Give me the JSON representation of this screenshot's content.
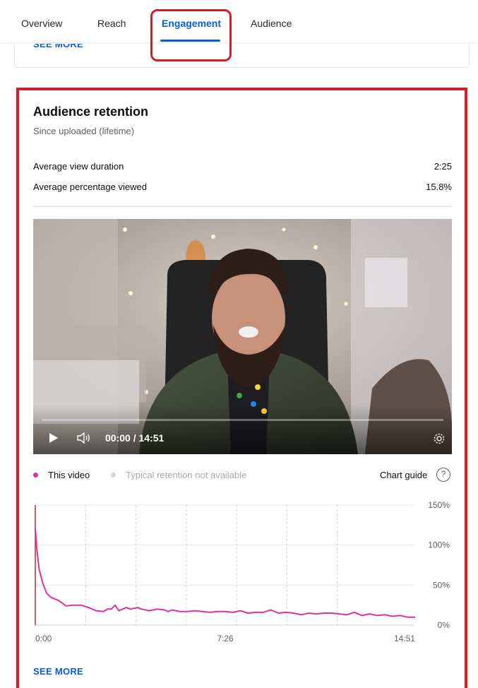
{
  "tabs": [
    {
      "label": "Overview"
    },
    {
      "label": "Reach"
    },
    {
      "label": "Engagement",
      "active": true
    },
    {
      "label": "Audience"
    }
  ],
  "top_card": {
    "see_more": "SEE MORE"
  },
  "retention": {
    "title": "Audience retention",
    "subtitle": "Since uploaded (lifetime)",
    "metrics": [
      {
        "label": "Average view duration",
        "value": "2:25"
      },
      {
        "label": "Average percentage viewed",
        "value": "15.8%"
      }
    ],
    "player": {
      "time": "00:00 / 14:51",
      "progress": 0,
      "icons": [
        "play-icon",
        "volume-icon",
        "settings-gear-icon"
      ]
    },
    "legend": {
      "this_video": "This video",
      "typical": "Typical retention not available",
      "chart_guide": "Chart guide",
      "help_icon": "?"
    },
    "see_more": "SEE MORE"
  },
  "colors": {
    "accent": "#065fd4",
    "series": "#e0309e",
    "highlight": "#d31d28",
    "start_marker": "#c62828"
  },
  "chart_data": {
    "type": "line",
    "title": "",
    "xlabel": "",
    "ylabel": "",
    "x_ticks": [
      "0:00",
      "7:26",
      "14:51"
    ],
    "y_ticks": [
      "0%",
      "50%",
      "100%",
      "150%"
    ],
    "ylim": [
      0,
      150
    ],
    "xlim": [
      0,
      100
    ],
    "grid": true,
    "series": [
      {
        "name": "This video",
        "x": [
          0,
          0.4,
          1,
          2,
          3,
          4,
          5,
          6,
          7,
          8,
          10,
          12,
          14,
          16,
          18,
          19,
          20,
          21,
          22,
          24,
          25,
          26,
          27,
          28,
          30,
          32,
          34,
          35,
          36,
          38,
          40,
          42,
          44,
          46,
          48,
          50,
          52,
          54,
          56,
          58,
          60,
          62,
          64,
          66,
          68,
          70,
          72,
          74,
          76,
          78,
          80,
          82,
          84,
          86,
          88,
          90,
          92,
          94,
          96,
          98,
          100
        ],
        "y": [
          121,
          95,
          70,
          52,
          40,
          35,
          33,
          31,
          28,
          24,
          25,
          25,
          22,
          18,
          17,
          20,
          20,
          25,
          18,
          22,
          20,
          21,
          22,
          20,
          18,
          20,
          19,
          17,
          19,
          17,
          17,
          18,
          17,
          16,
          17,
          17,
          16,
          18,
          15,
          16,
          16,
          19,
          15,
          16,
          15,
          13,
          15,
          14,
          15,
          15,
          14,
          13,
          16,
          12,
          14,
          12,
          13,
          11,
          12,
          10,
          10
        ]
      }
    ]
  }
}
